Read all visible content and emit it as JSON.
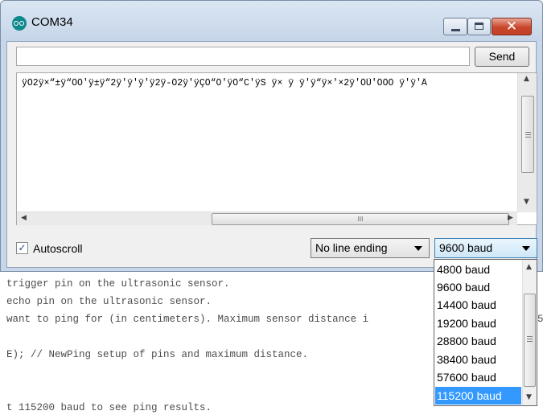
{
  "window": {
    "title": "COM34",
    "minimize_label": "",
    "maximize_label": "",
    "close_glyph": "✕"
  },
  "toolbar": {
    "input_value": "",
    "send_label": "Send"
  },
  "output": {
    "text": "ÿÕ2ÿ×“±ÿ“ÕÕ'ÿ±ÿ“2ÿ'ÿ'ÿ'ÿ2ÿ-Õ2ÿ'ÿÇÕ“Ô'ÿÕ“C'ÿS ÿ× ÿ ÿ'ÿ“ÿ×'×2ÿ'ÕÜ'ÔÕÕ ÿ'ÿ'Â"
  },
  "scrollbars": {
    "h_thumb_glyph": "III",
    "v_thumb_grip": "≡"
  },
  "footer": {
    "autoscroll_label": "Autoscroll",
    "autoscroll_checked": true,
    "line_ending_value": "No line ending",
    "baud_value": "9600 baud"
  },
  "baud_options": [
    {
      "label": "4800 baud",
      "selected": false
    },
    {
      "label": "9600 baud",
      "selected": false
    },
    {
      "label": "14400 baud",
      "selected": false
    },
    {
      "label": "19200 baud",
      "selected": false
    },
    {
      "label": "28800 baud",
      "selected": false
    },
    {
      "label": "38400 baud",
      "selected": false
    },
    {
      "label": "57600 baud",
      "selected": false
    },
    {
      "label": "115200 baud",
      "selected": true
    }
  ],
  "editor": {
    "lines": [
      "trigger pin on the ultrasonic sensor.",
      "echo pin on the ultrasonic sensor.",
      "want to ping for (in centimeters). Maximum sensor distance i",
      "",
      "E); // NewPing setup of pins and maximum distance.",
      "",
      "",
      "t 115200 baud to see ping results."
    ],
    "overflow_fragment": "5"
  },
  "colors": {
    "selection": "#3399ff",
    "title_bar": "#c5d5e8",
    "close_button": "#c9462b"
  }
}
